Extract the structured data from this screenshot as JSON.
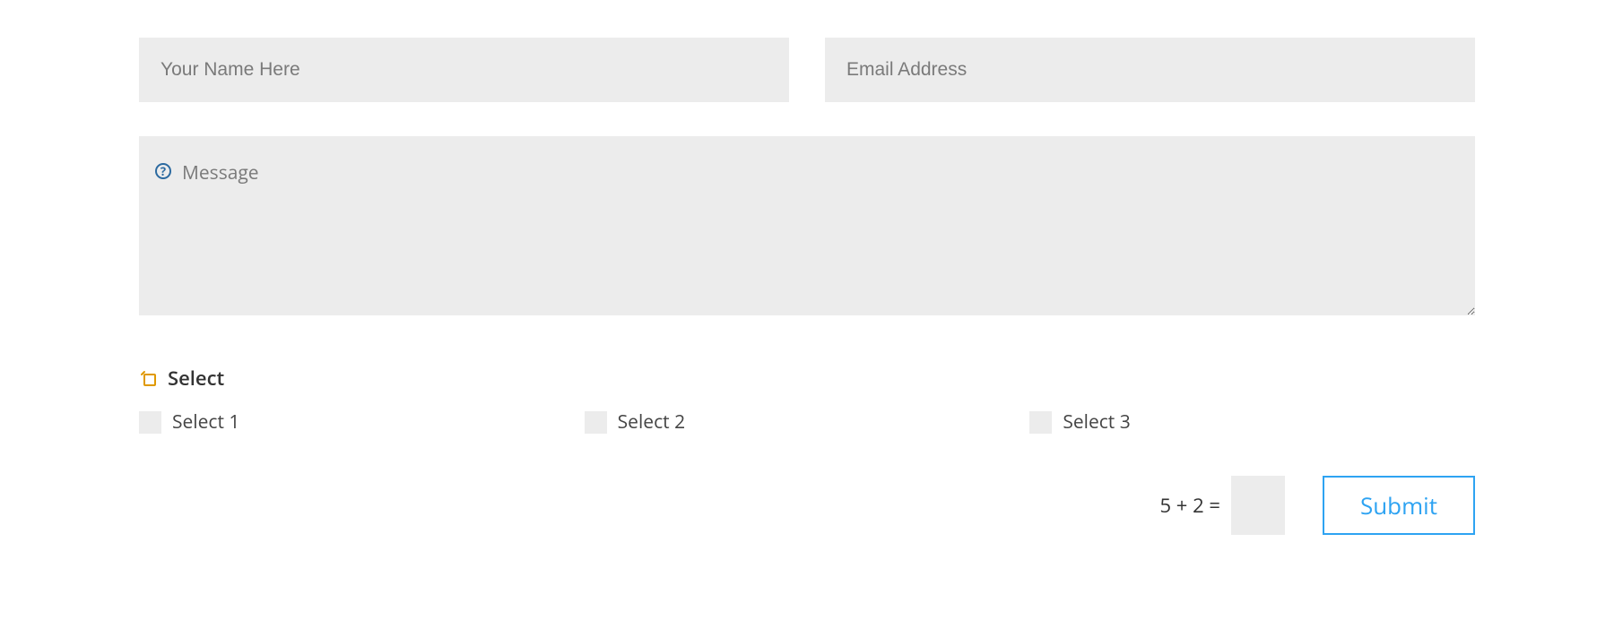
{
  "form": {
    "name": {
      "placeholder": "Your Name Here",
      "value": ""
    },
    "email": {
      "placeholder": "Email Address",
      "value": ""
    },
    "message": {
      "placeholder": "Message",
      "value": "",
      "help_icon": "?"
    },
    "select": {
      "title": "Select",
      "options": [
        {
          "label": "Select 1",
          "checked": false
        },
        {
          "label": "Select 2",
          "checked": false
        },
        {
          "label": "Select 3",
          "checked": false
        }
      ]
    },
    "captcha": {
      "question": "5 + 2 =",
      "value": ""
    },
    "submit_label": "Submit"
  },
  "colors": {
    "field_bg": "#ececec",
    "accent_blue": "#2ea3f2",
    "icon_blue": "#2c6aa0",
    "icon_orange": "#e09900"
  }
}
